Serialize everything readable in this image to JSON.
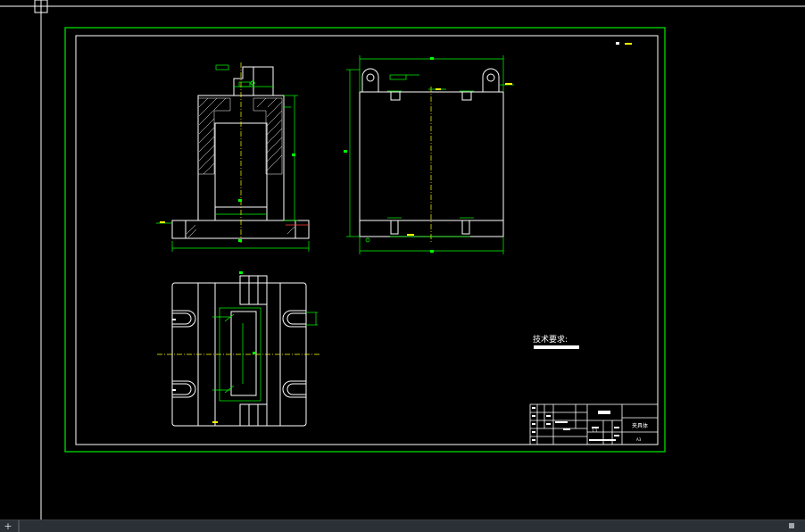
{
  "colors": {
    "background": "#000000",
    "frame": "#00c000",
    "border": "#ffffff",
    "line": "#ffffff",
    "dimension": "#00ff00",
    "centerline": "#ffff00",
    "hatch": "#ffffff",
    "statusbar": "#2b2f36"
  },
  "drawing": {
    "notes_title": "技术要求:",
    "title_block": {
      "name": "夹具体",
      "scale": "1:1",
      "tag": "A3"
    }
  },
  "statusbar": {
    "add_tab": "+"
  }
}
